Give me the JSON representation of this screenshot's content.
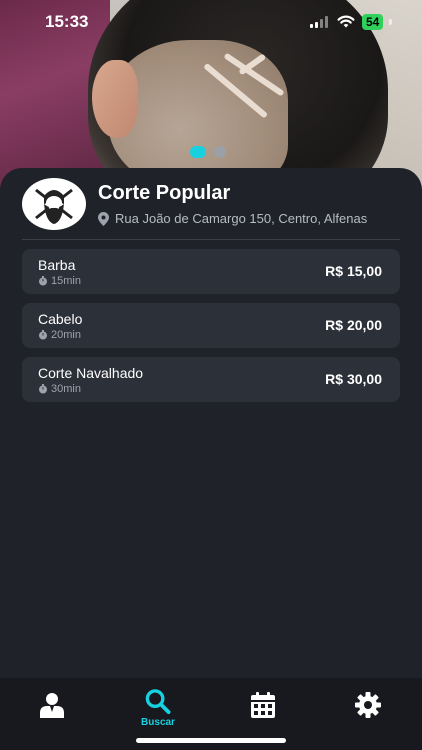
{
  "status_bar": {
    "time": "15:33",
    "battery": "54"
  },
  "carousel": {
    "active_index": 0,
    "count": 2
  },
  "shop": {
    "name": "Corte Popular",
    "address": "Rua João de Camargo 150, Centro, Alfenas"
  },
  "services": [
    {
      "name": "Barba",
      "duration": "15min",
      "price": "R$ 15,00"
    },
    {
      "name": "Cabelo",
      "duration": "20min",
      "price": "R$ 20,00"
    },
    {
      "name": "Corte Navalhado",
      "duration": "30min",
      "price": "R$ 30,00"
    }
  ],
  "nav": {
    "active": "search",
    "search_label": "Buscar",
    "accent": "#17d1e0"
  }
}
